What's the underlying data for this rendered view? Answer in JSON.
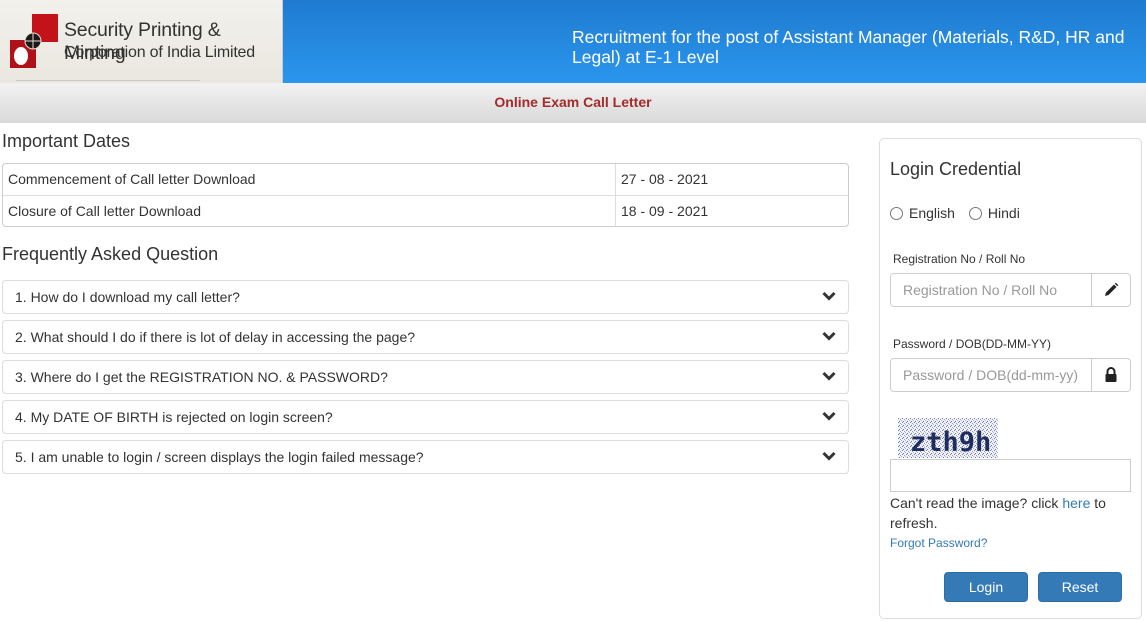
{
  "header": {
    "logo": {
      "line1": "Security Printing & Minting",
      "line2": "Corporation of India Limited",
      "colors": {
        "red": "#c4121a",
        "dark": "#1a1a1a"
      }
    },
    "title": "Recruitment for the post of Assistant Manager (Materials, R&D, HR and Legal) at E-1 Level",
    "colors": {
      "blue_top": "#1f7bcf",
      "blue_bottom": "#2a96ee"
    }
  },
  "subbar": {
    "title": "Online Exam Call Letter",
    "title_color": "#a52a2a"
  },
  "important_dates": {
    "title": "Important Dates",
    "rows": [
      {
        "label": "Commencement of Call letter Download",
        "value": "27 - 08 - 2021"
      },
      {
        "label": "Closure of Call letter Download",
        "value": "18 - 09 - 2021"
      }
    ]
  },
  "faq": {
    "title": "Frequently Asked Question",
    "items": [
      {
        "question": "1. How do I download my call letter?",
        "icon": "chevron-down-icon"
      },
      {
        "question": "2. What should I do if there is lot of delay in accessing the page?",
        "icon": "chevron-down-icon"
      },
      {
        "question": "3. Where do I get the REGISTRATION NO. & PASSWORD?",
        "icon": "chevron-down-icon"
      },
      {
        "question": "4. My DATE OF BIRTH is rejected on login screen?",
        "icon": "chevron-down-icon"
      },
      {
        "question": "5. I am unable to login / screen displays the login failed message?",
        "icon": "chevron-down-icon"
      }
    ]
  },
  "login": {
    "title": "Login Credential",
    "languages": [
      {
        "label": "English",
        "selected": false
      },
      {
        "label": "Hindi",
        "selected": false
      }
    ],
    "registration": {
      "label": "Registration No / Roll No",
      "placeholder": "Registration No / Roll No",
      "value": "",
      "icon": "pencil-icon"
    },
    "password": {
      "label": "Password / DOB(DD-MM-YY)",
      "placeholder": "Password / DOB(dd-mm-yy)",
      "value": "",
      "icon": "lock-icon"
    },
    "captcha": {
      "text": "zth9h",
      "input_value": ""
    },
    "refresh_prefix": "Can't read the image? click ",
    "refresh_link": "here",
    "refresh_suffix": " to refresh.",
    "forgot_password": "Forgot Password?",
    "login_button": "Login",
    "reset_button": "Reset",
    "button_color": "#337ab7",
    "link_color": "#337ab7"
  }
}
